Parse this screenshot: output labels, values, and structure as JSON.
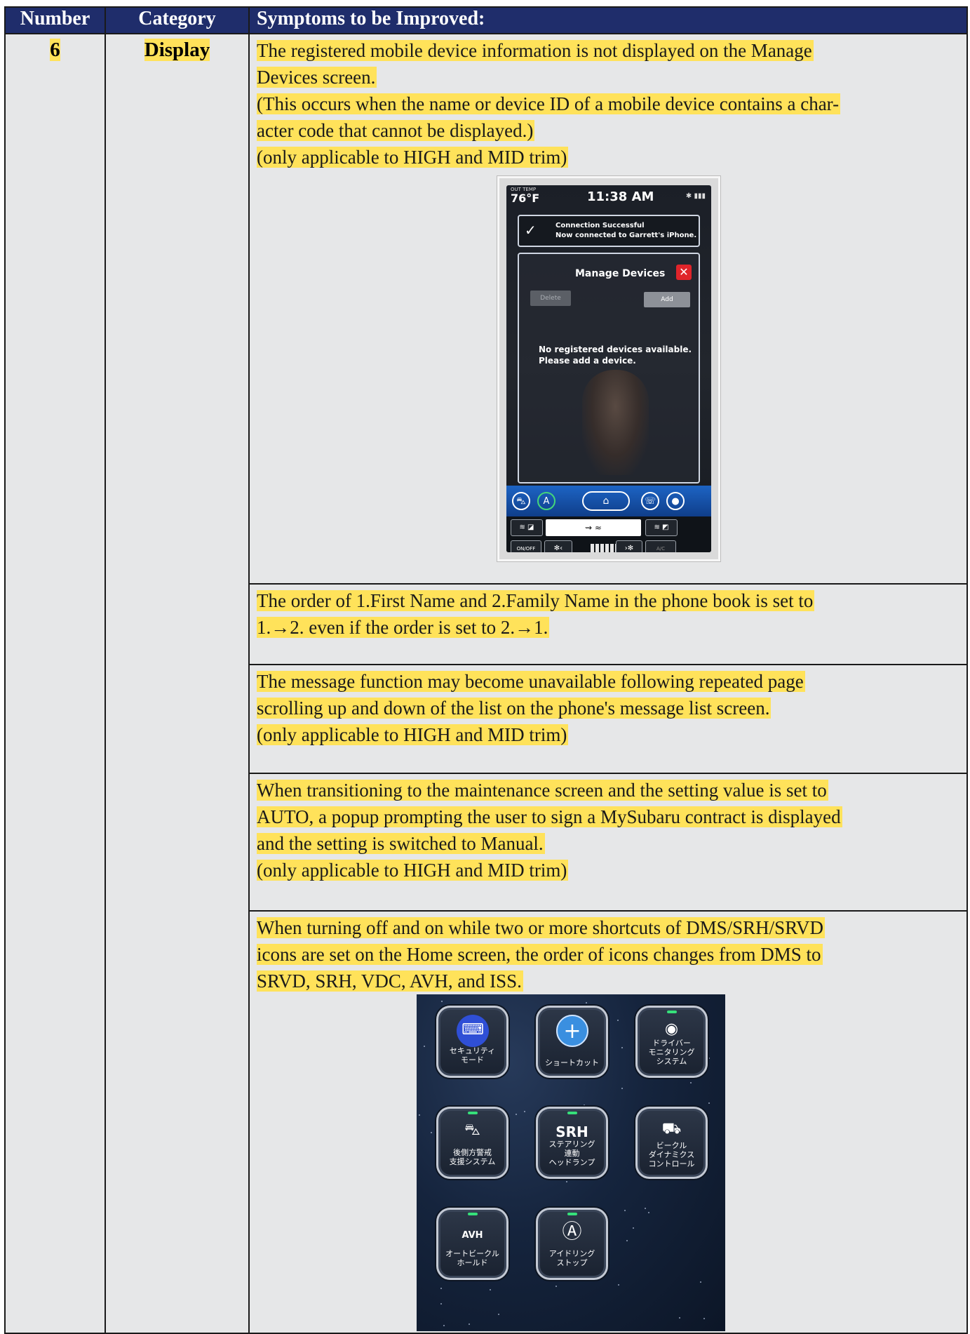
{
  "table": {
    "headers": {
      "number": "Number",
      "category": "Category",
      "symptoms": "Symptoms to be Improved:"
    },
    "row": {
      "number": "6",
      "category": "Display",
      "items": [
        {
          "lines": [
            "The registered mobile device information is not displayed on the Manage",
            "Devices screen.",
            "(This occurs when the name or device ID of a mobile device contains a char-",
            "acter code that cannot be displayed.)",
            "(only applicable to HIGH and MID trim)"
          ]
        },
        {
          "lines": [
            "The order of 1.First Name and 2.Family Name in the phone book is set to",
            "1.→2. even if the order is set to 2.→1."
          ]
        },
        {
          "lines": [
            "The message function may become unavailable following repeated page",
            "scrolling up and down of the list on the phone's message list screen.",
            "(only applicable to HIGH and MID trim)"
          ]
        },
        {
          "lines": [
            "When transitioning to the maintenance screen and the setting value is set to",
            "AUTO, a popup prompting the user to sign a MySubaru contract is displayed",
            "and the setting is switched to Manual.",
            "(only applicable to HIGH and MID trim)"
          ]
        },
        {
          "lines": [
            "When turning off and on while two or more shortcuts of DMS/SRH/SRVD",
            "icons are set on the Home screen, the order of icons changes from DMS to",
            "SRVD, SRH, VDC, AVH, and ISS."
          ]
        }
      ]
    }
  },
  "phone_screenshot": {
    "out_temp_label": "OUT TEMP",
    "temperature": "76°F",
    "clock": "11:38 AM",
    "toast_line1": "Connection Successful",
    "toast_line2": "Now connected to Garrett's iPhone.",
    "title": "Manage Devices",
    "close": "✕",
    "delete": "Delete",
    "add": "Add",
    "message_line1": "No registered devices available.",
    "message_line2": "Please add a device.",
    "on_off": "ON/OFF",
    "ac": "A/C",
    "highlight_color": "#ffe25a",
    "header_color": "#1f2d6b"
  },
  "icon_screenshot": {
    "tiles": [
      {
        "icon": "security-icon",
        "glyph": "⌨",
        "label": "セキュリティ\nモード"
      },
      {
        "icon": "shortcut-plus-icon",
        "glyph": "+",
        "label": "ショートカット"
      },
      {
        "icon": "driver-monitor-icon",
        "glyph": "◉",
        "label": "ドライバー\nモニタリング\nシステム"
      },
      {
        "icon": "rear-warning-icon",
        "glyph": "⛍",
        "label": "後側方警戒\n支援システム"
      },
      {
        "icon": "srh-icon",
        "glyph": "SRH",
        "label": "ステアリング\n連動\nヘッドランプ"
      },
      {
        "icon": "vdc-off-icon",
        "glyph": "⛟",
        "label": "ビークル\nダイナミクス\nコントロール"
      },
      {
        "icon": "avh-icon",
        "glyph": "AVH",
        "label": "オートビークル\nホールド"
      },
      {
        "icon": "idling-stop-icon",
        "glyph": "Ⓐ",
        "label": "アイドリング\nストップ"
      }
    ]
  }
}
